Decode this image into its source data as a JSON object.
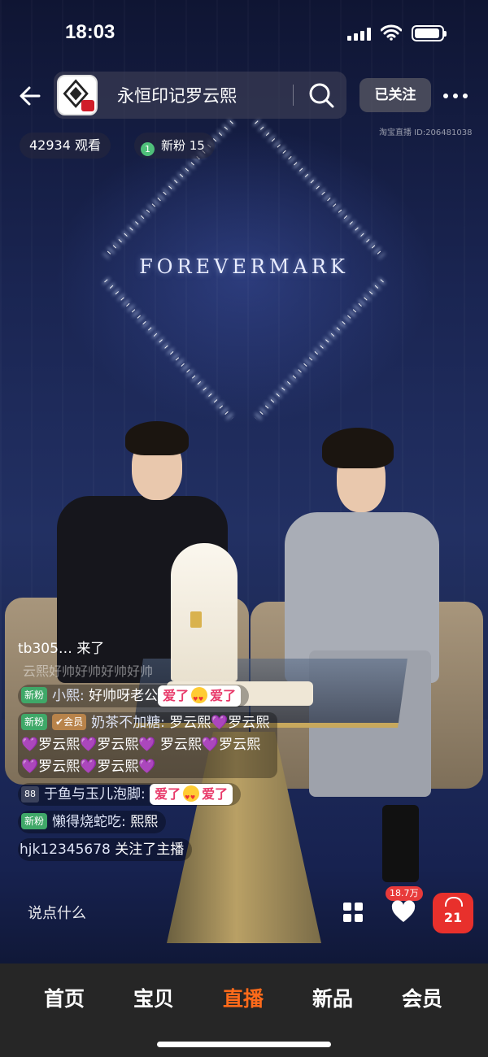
{
  "status_bar": {
    "time": "18:03"
  },
  "header": {
    "store_name": "永恒印记罗云熙",
    "follow_label": "已关注",
    "viewers": "42934 观看",
    "new_fans": "新粉 15",
    "new_fans_rank": "1",
    "live_id": "淘宝直播 ID:206481038"
  },
  "stage": {
    "brand_logo": "FOREVERMARK"
  },
  "comments": {
    "join_notice": {
      "user": "tb305…",
      "text": "来了"
    },
    "faded": "云熙好帅好帅好帅好帅",
    "items": [
      {
        "tag": "新粉",
        "user": "小熙:",
        "text": "好帅呀老公",
        "sticker": [
          "爱了",
          "爱了"
        ]
      },
      {
        "tag": "新粉",
        "tag2": "✔会员",
        "user": "奶茶不加糖:",
        "text": "罗云熙💜罗云熙",
        "text2": "💜罗云熙💜罗云熙💜 罗云熙💜罗云熙",
        "text3": "💜罗云熙💜罗云熙💜"
      },
      {
        "tag": "88",
        "user": "于鱼与玉儿泡脚:",
        "sticker": [
          "爱了",
          "爱了"
        ]
      },
      {
        "tag": "新粉",
        "user": "懒得烧蛇吃:",
        "text": "熙熙"
      }
    ],
    "follow_notice": {
      "user": "hjk12345678",
      "text": "关注了主播"
    }
  },
  "bottom_actions": {
    "input_placeholder": "说点什么",
    "like_count": "18.7万",
    "cart_count": "21"
  },
  "tabs": [
    {
      "label": "首页",
      "active": false
    },
    {
      "label": "宝贝",
      "active": false
    },
    {
      "label": "直播",
      "active": true
    },
    {
      "label": "新品",
      "active": false
    },
    {
      "label": "会员",
      "active": false
    }
  ],
  "colors": {
    "accent": "#ff6a1a",
    "cart": "#e8302c",
    "new_fan_tag": "#3fa868"
  }
}
